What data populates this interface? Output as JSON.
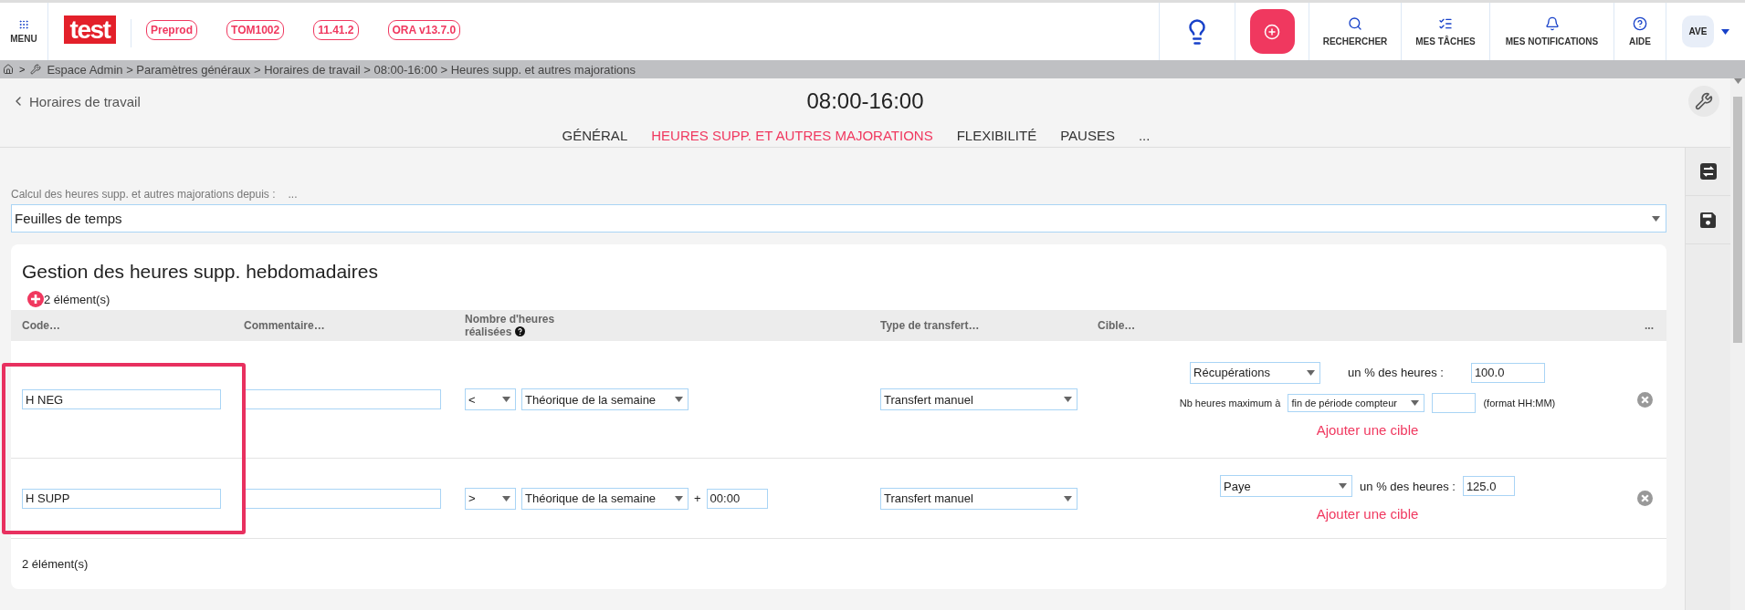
{
  "topbar": {
    "menu_label": "MENU",
    "logo": "test",
    "chips": [
      "Preprod",
      "TOM1002",
      "11.41.2",
      "ORA v13.7.0"
    ],
    "actions": [
      {
        "label": "RECHERCHER"
      },
      {
        "label": "MES TÂCHES"
      },
      {
        "label": "MES NOTIFICATIONS"
      },
      {
        "label": "AIDE"
      }
    ],
    "user": {
      "initials": "AVE"
    }
  },
  "breadcrumb": {
    "separator": ">",
    "path": "Espace Admin > Paramètres généraux > Horaires de travail > 08:00-16:00 > Heures supp. et autres majorations"
  },
  "header": {
    "back_link": "Horaires de travail",
    "title": "08:00-16:00"
  },
  "tabs": [
    {
      "label": "GÉNÉRAL",
      "selected": false
    },
    {
      "label": "HEURES SUPP. ET AUTRES MAJORATIONS",
      "selected": true
    },
    {
      "label": "FLEXIBILITÉ",
      "selected": false
    },
    {
      "label": "PAUSES",
      "selected": false
    },
    {
      "label": "...",
      "selected": false
    }
  ],
  "source_field": {
    "label": "Calcul des heures supp. et autres majorations depuis :",
    "hint": "...",
    "value": "Feuilles de temps"
  },
  "section": {
    "title": "Gestion des heures supp. hebdomadaires",
    "count": "2 élément(s)",
    "columns": [
      {
        "label": "Code…"
      },
      {
        "label": "Commentaire…"
      },
      {
        "label": "Nombre d'heures réalisées",
        "help": true
      },
      {
        "label": "Type de transfert…"
      },
      {
        "label": "Cible…"
      },
      {
        "label": "..."
      }
    ],
    "rows": [
      {
        "code": "H NEG",
        "operator": "<",
        "reference": "Théorique de la semaine",
        "transfer": "Transfert manuel",
        "targets": [
          {
            "type": "Récupérations",
            "percent_label": "un % des heures :",
            "percent": "100.0",
            "max_label": "Nb heures maximum à",
            "max_period": "fin de période compteur",
            "max_hint": "(format HH:MM)"
          }
        ],
        "add_target": "Ajouter une cible"
      },
      {
        "code": "H SUPP",
        "operator": ">",
        "reference": "Théorique de la semaine",
        "plus": "+",
        "offset": "00:00",
        "transfer": "Transfert manuel",
        "targets": [
          {
            "type": "Paye",
            "percent_label": "un % des heures :",
            "percent": "125.0"
          }
        ],
        "add_target": "Ajouter une cible"
      }
    ],
    "footer": "2 élément(s)"
  }
}
